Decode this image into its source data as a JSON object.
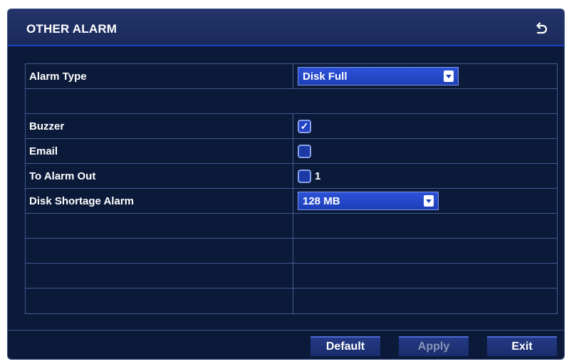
{
  "window": {
    "title": "OTHER ALARM",
    "back_icon": "return-arrow-icon"
  },
  "rows": {
    "alarm_type": {
      "label": "Alarm Type",
      "value": "Disk Full"
    },
    "buzzer": {
      "label": "Buzzer",
      "checked": true,
      "check_glyph": "✓"
    },
    "email": {
      "label": "Email",
      "checked": false,
      "check_glyph": ""
    },
    "to_alarm_out": {
      "label": "To Alarm Out",
      "checked": false,
      "check_glyph": "",
      "channel": "1"
    },
    "disk_shortage": {
      "label": "Disk Shortage Alarm",
      "value": "128 MB"
    }
  },
  "buttons": {
    "default_label": "Default",
    "apply_label": "Apply",
    "exit_label": "Exit"
  },
  "colors": {
    "background": "#0c1a3a",
    "accent": "#1d3fb8",
    "grid_line": "#3f5a8e",
    "text": "#ffffff",
    "disabled_text": "#8a96b8"
  }
}
